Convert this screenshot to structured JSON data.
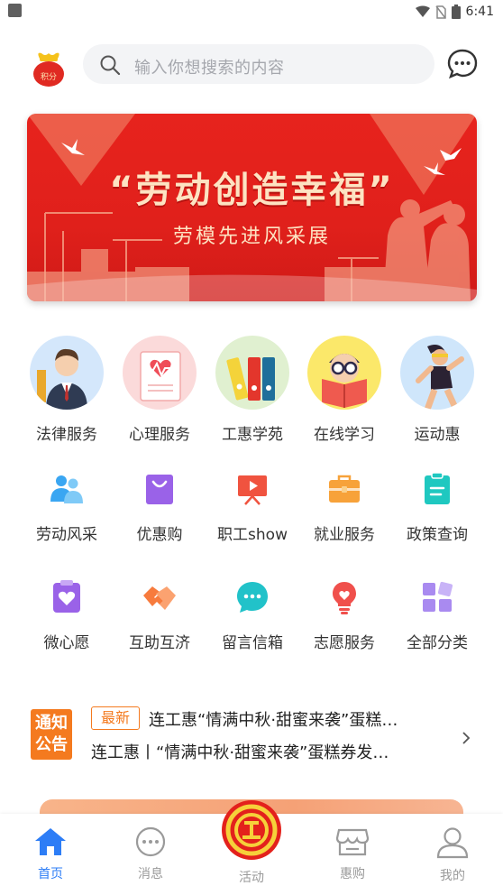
{
  "status_bar": {
    "time": "6:41"
  },
  "header": {
    "points_icon_text": "积分",
    "search_placeholder": "输入你想搜索的内容"
  },
  "banner": {
    "title": "“劳动创造幸福”",
    "subtitle": "劳模先进风采展"
  },
  "round_services": [
    {
      "label": "法律服务",
      "icon": "lawyer-icon"
    },
    {
      "label": "心理服务",
      "icon": "heart-report-icon"
    },
    {
      "label": "工惠学苑",
      "icon": "binders-icon"
    },
    {
      "label": "在线学习",
      "icon": "reading-icon"
    },
    {
      "label": "运动惠",
      "icon": "runner-icon"
    }
  ],
  "grid_row1": [
    {
      "label": "劳动风采",
      "icon": "people-icon",
      "color": "#3aa6f2"
    },
    {
      "label": "优惠购",
      "icon": "shopping-bag-icon",
      "color": "#9a62e8"
    },
    {
      "label": "职工show",
      "icon": "presentation-icon",
      "color": "#f0533f"
    },
    {
      "label": "就业服务",
      "icon": "briefcase-icon",
      "color": "#f7a23a"
    },
    {
      "label": "政策查询",
      "icon": "clipboard-icon",
      "color": "#1fc8c0"
    }
  ],
  "grid_row2": [
    {
      "label": "微心愿",
      "icon": "heart-card-icon",
      "color": "#9a62e8"
    },
    {
      "label": "互助互济",
      "icon": "handshake-icon",
      "color": "#f77b3d"
    },
    {
      "label": "留言信箱",
      "icon": "chat-bubble-icon",
      "color": "#21c2c9"
    },
    {
      "label": "志愿服务",
      "icon": "lightbulb-icon",
      "color": "#f0504c"
    },
    {
      "label": "全部分类",
      "icon": "grid-icon",
      "color": "#a98af0"
    }
  ],
  "notice": {
    "badge": [
      "通知",
      "公告"
    ],
    "tag": "最新",
    "line1": "连工惠“情满中秋·甜蜜来袭”蛋糕…",
    "line2": "连工惠丨“情满中秋·甜蜜来袭”蛋糕券发…"
  },
  "tabbar": {
    "home": "首页",
    "messages": "消息",
    "activities": "活动",
    "deals": "惠购",
    "mine": "我的"
  },
  "colors": {
    "accent": "#2d7df6",
    "notice_orange": "#f47a1f",
    "banner_red": "#e3211c"
  }
}
